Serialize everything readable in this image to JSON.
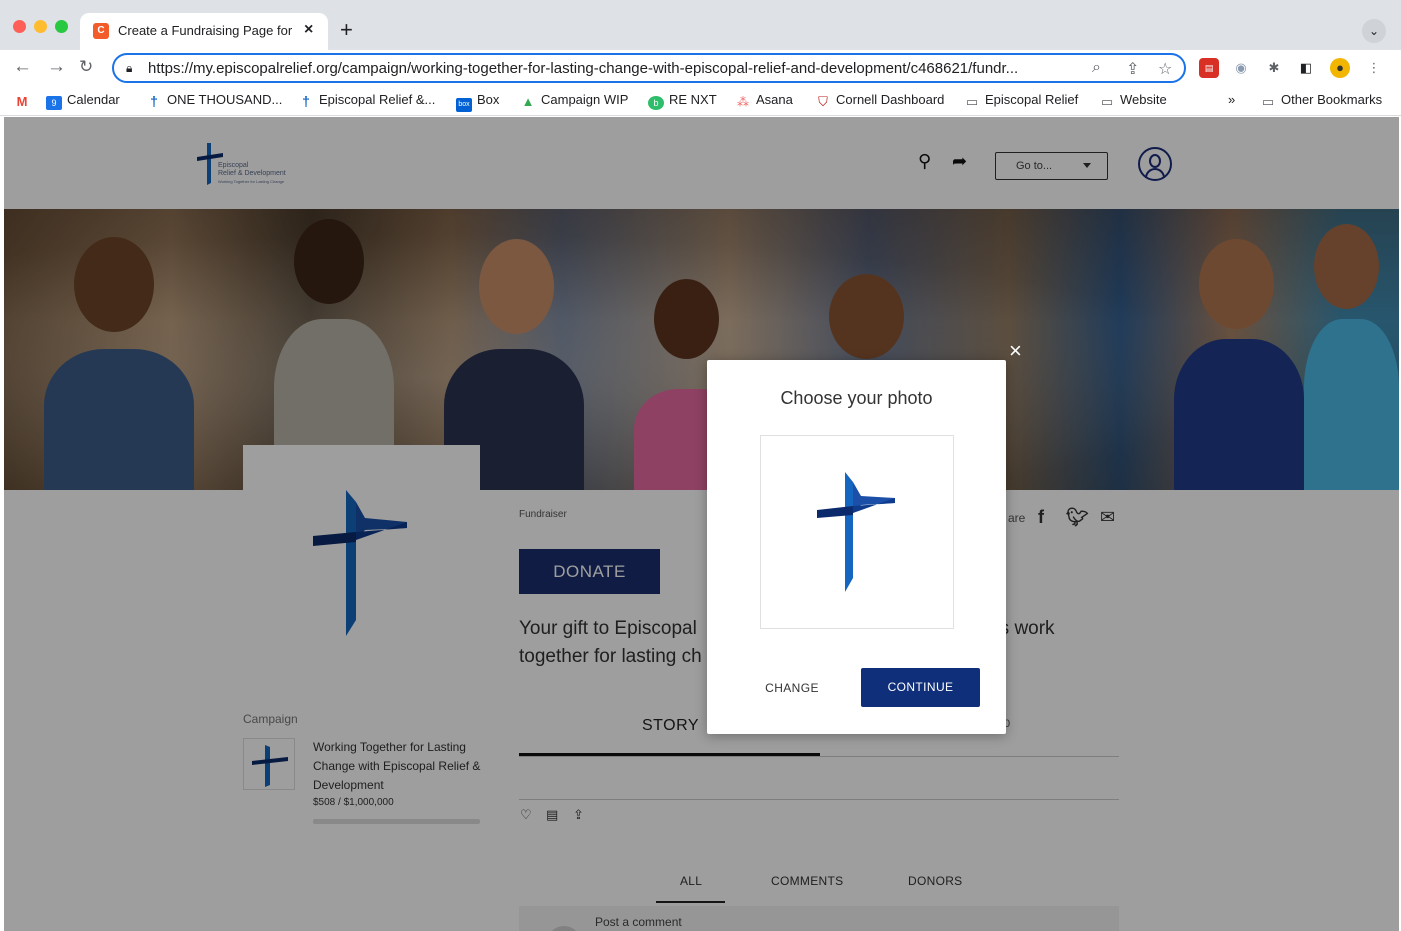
{
  "browser": {
    "tab_title": "Create a Fundraising Page for …",
    "tab_favicon_letter": "C",
    "url": "https://my.episcopalrelief.org/campaign/working-together-for-lasting-change-with-episcopal-relief-and-development/c468621/fundr...",
    "bookmarks": [
      {
        "label": "",
        "icon": "gmail-icon"
      },
      {
        "label": "Calendar",
        "icon": "calendar-icon"
      },
      {
        "label": "ONE THOUSAND...",
        "icon": "cross-icon"
      },
      {
        "label": "Episcopal Relief &...",
        "icon": "cross-icon"
      },
      {
        "label": "Box",
        "icon": "box-icon"
      },
      {
        "label": "Campaign WIP",
        "icon": "drive-icon"
      },
      {
        "label": "RE NXT",
        "icon": "re-icon"
      },
      {
        "label": "Asana",
        "icon": "asana-icon"
      },
      {
        "label": "Cornell Dashboard",
        "icon": "shield-icon"
      },
      {
        "label": "Episcopal Relief",
        "icon": "folder-icon"
      },
      {
        "label": "Website",
        "icon": "folder-icon"
      }
    ],
    "more_bookmarks": "»",
    "other_bookmarks": "Other Bookmarks"
  },
  "site": {
    "logo_line1": "Episcopal",
    "logo_line2": "Relief & Development",
    "logo_tagline": "Working Together for Lasting Change",
    "goto_label": "Go to..."
  },
  "page": {
    "fundraiser_label": "Fundraiser",
    "share_label": "are",
    "donate_label": "DONATE",
    "gift_text_left": "Your gift to Episcopal",
    "gift_text_right": "nities work",
    "gift_text_line2": "together for lasting ch",
    "campaign_label": "Campaign",
    "campaign_title": "Working Together for Lasting Change with Episcopal Relief & Development",
    "campaign_amount": "$508 / $1,000,000",
    "campaign_progress": 0.0005,
    "tab_story": "STORY",
    "tab_count": "0",
    "feed_tabs": [
      "ALL",
      "COMMENTS",
      "DONORS"
    ],
    "comment_placeholder": "Post a comment"
  },
  "modal": {
    "title": "Choose your photo",
    "change_label": "CHANGE",
    "continue_label": "CONTINUE",
    "close_symbol": "×"
  },
  "colors": {
    "brand_navy": "#1b2e6e",
    "cross_blue": "#1566c0",
    "cross_dark": "#0b2a6b",
    "url_focus": "#1a73e8"
  }
}
